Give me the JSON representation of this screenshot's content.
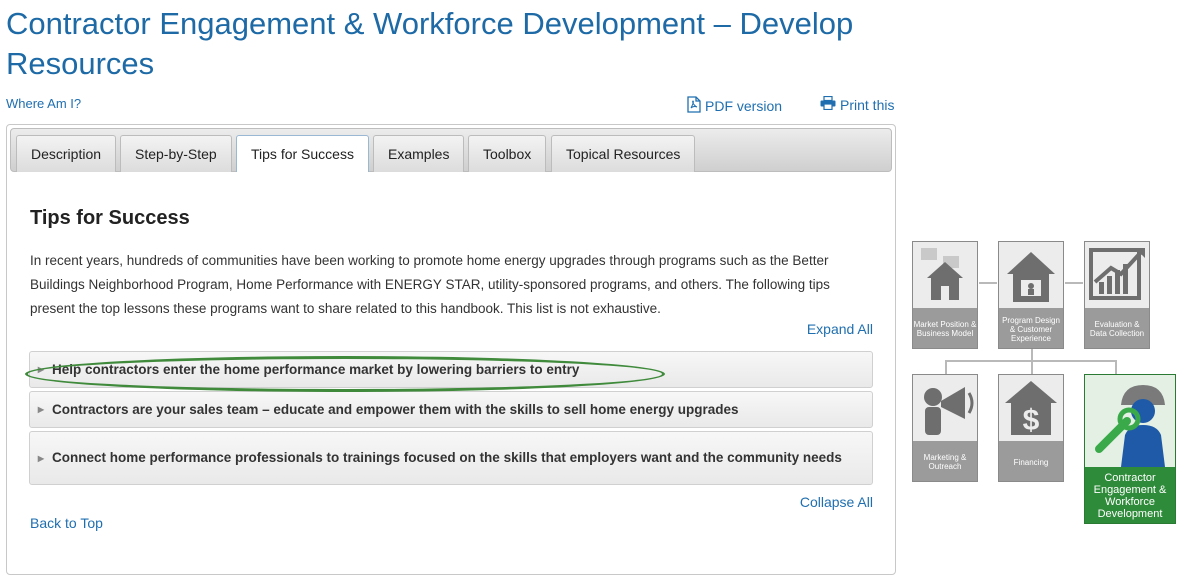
{
  "page": {
    "title": "Contractor Engagement & Workforce Development – Develop Resources",
    "where_am_i": "Where Am I?",
    "pdf_label": "PDF version",
    "print_label": "Print this"
  },
  "tabs": [
    {
      "label": "Description"
    },
    {
      "label": "Step-by-Step"
    },
    {
      "label": "Tips for Success"
    },
    {
      "label": "Examples"
    },
    {
      "label": "Toolbox"
    },
    {
      "label": "Topical Resources"
    }
  ],
  "active_tab": "Tips for Success",
  "content": {
    "heading": "Tips for Success",
    "intro": "In recent years, hundreds of communities have been working to promote home energy upgrades through programs such as the Better Buildings Neighborhood Program, Home Performance with ENERGY STAR, utility-sponsored programs, and others. The following tips present the top lessons these programs want to share related to this handbook. This list is not exhaustive.",
    "expand_all": "Expand All",
    "collapse_all": "Collapse All",
    "back_to_top": "Back to Top",
    "accordion": [
      {
        "label": "Help contractors enter the home performance market by lowering barriers to entry"
      },
      {
        "label": "Contractors are your sales team – educate and empower them with the skills to sell home energy upgrades"
      },
      {
        "label": "Connect home performance professionals to trainings focused on the skills that employers want and the community needs"
      }
    ]
  },
  "diagram": {
    "tiles": [
      {
        "label": "Market Position & Business Model",
        "icon": "houses-icon"
      },
      {
        "label": "Program Design & Customer Experience",
        "icon": "house-person-icon"
      },
      {
        "label": "Evaluation & Data Collection",
        "icon": "chart-icon"
      },
      {
        "label": "Marketing & Outreach",
        "icon": "megaphone-icon"
      },
      {
        "label": "Financing",
        "icon": "dollar-house-icon"
      },
      {
        "label": "Contractor Engagement & Workforce Development",
        "icon": "worker-wrench-icon"
      }
    ],
    "colors": {
      "tile": "#9b9b9b",
      "active": "#2e8b3a",
      "link": "#1f6fb0",
      "highlight": "#3f8a3b"
    }
  }
}
